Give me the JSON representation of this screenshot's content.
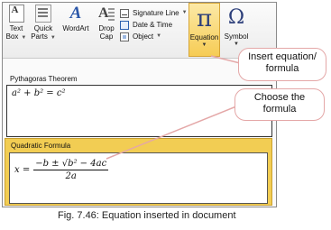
{
  "ribbon": {
    "text_box": [
      "Text",
      "Box"
    ],
    "quick_parts": [
      "Quick",
      "Parts"
    ],
    "wordart": "WordArt",
    "drop_cap": [
      "Drop",
      "Cap"
    ],
    "signature_line": "Signature Line",
    "date_time": "Date & Time",
    "object": "Object",
    "equation": "Equation",
    "symbol": "Symbol",
    "equation_glyph": "π",
    "symbol_glyph": "Ω"
  },
  "document": {
    "pythagoras_title": "Pythagoras Theorem",
    "pythagoras_eq": "a² + b² = c²",
    "quadratic_title": "Quadratic Formula",
    "quadratic_lhs": "x =",
    "quadratic_num": "−b ± √b² − 4ac",
    "quadratic_den": "2a"
  },
  "callouts": {
    "insert": [
      "Insert equation/",
      "formula"
    ],
    "choose": [
      "Choose the",
      "formula"
    ]
  },
  "caption": "Fig. 7.46: Equation inserted in document",
  "colors": {
    "highlight": "#f2cd53",
    "callout_border": "#e4a7a7",
    "glyph": "#2d3f7a"
  }
}
